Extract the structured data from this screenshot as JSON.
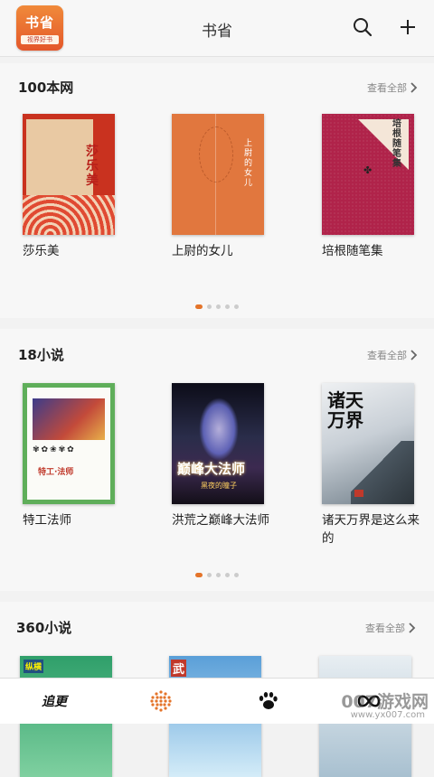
{
  "header": {
    "logo_line1": "书省",
    "logo_line2": "视界好书",
    "title": "书省",
    "search_icon": "search-icon",
    "add_icon": "plus-icon"
  },
  "sections": [
    {
      "title": "100本网",
      "more": "查看全部",
      "books": [
        {
          "title": "莎乐美",
          "cover_text": "莎乐美"
        },
        {
          "title": "上尉的女儿",
          "cover_text": "上尉的女儿"
        },
        {
          "title": "培根随笔集",
          "cover_text": "培根随笔集"
        }
      ],
      "page_count": 5,
      "active_page": 1
    },
    {
      "title": "18小说",
      "more": "查看全部",
      "books": [
        {
          "title": "特工法师",
          "cover_text": "特工·法师"
        },
        {
          "title": "洪荒之巅峰大法师",
          "cover_text": "巅峰大法师",
          "cover_author": "黑夜的瞳子"
        },
        {
          "title": "诸天万界是这么来的",
          "cover_text": "诸天万界"
        }
      ],
      "page_count": 5,
      "active_page": 1
    },
    {
      "title": "360小说",
      "more": "查看全部",
      "books": [
        {
          "title": "",
          "cover_text": "纵横"
        },
        {
          "title": "",
          "cover_text": "武"
        },
        {
          "title": "",
          "cover_text": ""
        }
      ]
    }
  ],
  "bottom_nav": [
    {
      "label": "追更",
      "icon": "calligraphy-icon"
    },
    {
      "label": "",
      "icon": "dots-grid-icon"
    },
    {
      "label": "",
      "icon": "paw-icon"
    },
    {
      "label": "",
      "icon": "infinity-icon"
    }
  ],
  "watermark": {
    "main": "007游戏网",
    "sub": "www.yx007.com"
  },
  "colors": {
    "accent": "#e4742a",
    "background": "#f2f2f2",
    "card": "#f7f7f7"
  }
}
